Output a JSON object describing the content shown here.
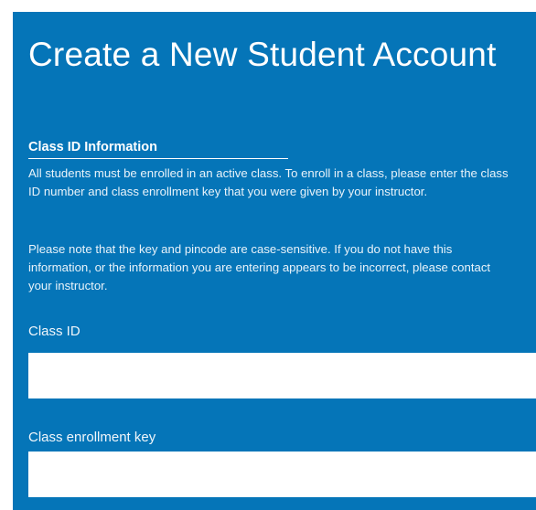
{
  "form": {
    "title": "Create a New Student Account",
    "section_heading": "Class ID Information",
    "paragraph_1": "All students must be enrolled in an active class. To enroll in a class, please enter the class ID number and class enrollment key that you were given by your instructor.",
    "paragraph_2": "Please note that the key and pincode are case-sensitive. If you do not have this information, or the information you are entering appears to be incorrect, please contact your instructor.",
    "class_id": {
      "label": "Class ID",
      "value": "",
      "placeholder": ""
    },
    "enrollment_key": {
      "label": "Class enrollment key",
      "value": "",
      "placeholder": ""
    }
  },
  "colors": {
    "panel_background": "#0575b8",
    "text": "#ffffff",
    "input_background": "#ffffff"
  }
}
